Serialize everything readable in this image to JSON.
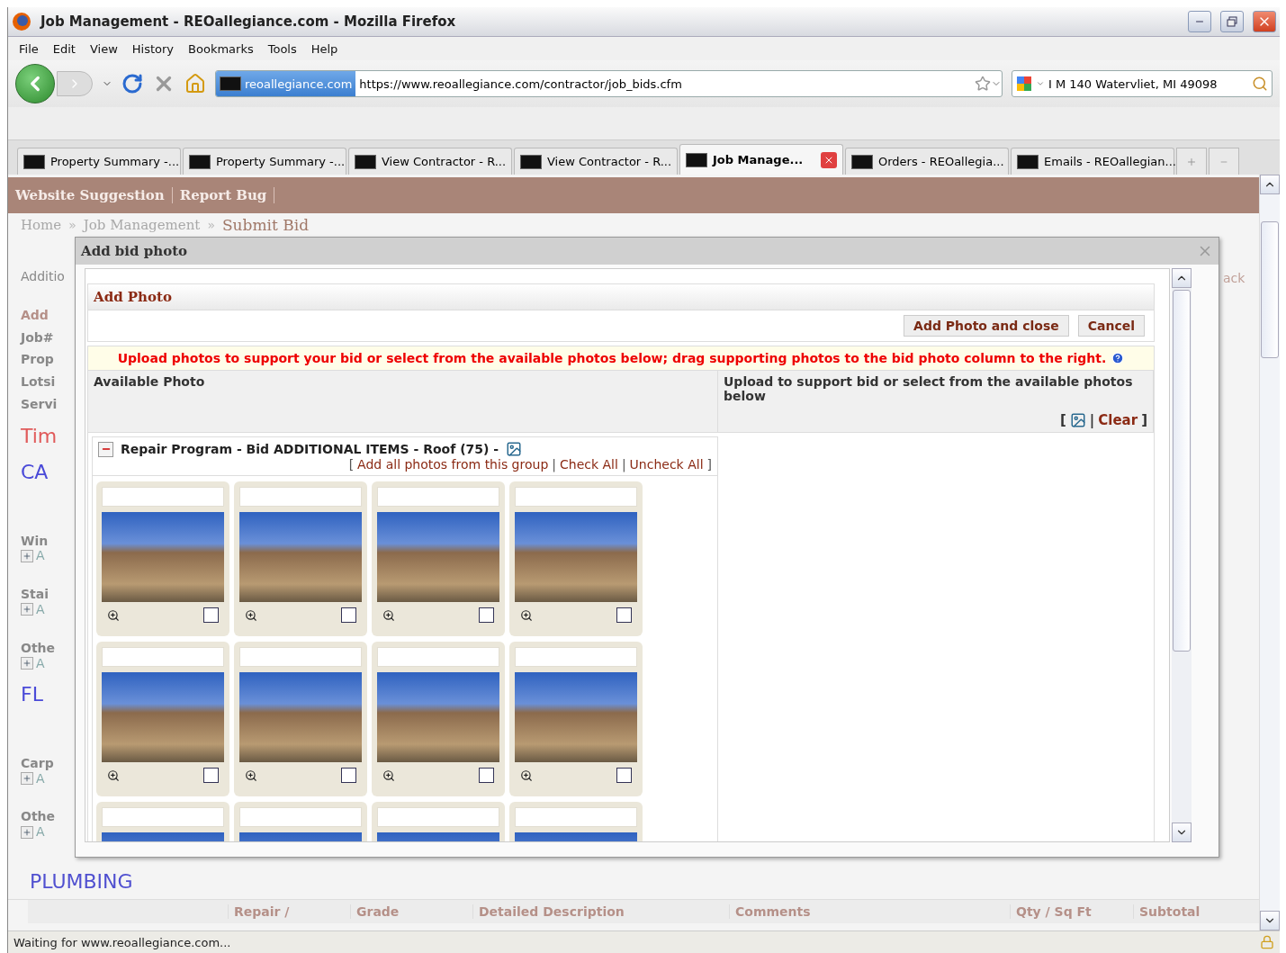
{
  "window": {
    "title": "Job Management - REOallegiance.com - Mozilla Firefox"
  },
  "menu": [
    "File",
    "Edit",
    "View",
    "History",
    "Bookmarks",
    "Tools",
    "Help"
  ],
  "address_bar": {
    "site_badge": "reoallegiance.com",
    "url": "https://www.reoallegiance.com/contractor/job_bids.cfm"
  },
  "search_bar": {
    "value": "I M 140  Watervliet, MI 49098"
  },
  "tabs": [
    {
      "label": "Property Summary -...",
      "selected": false
    },
    {
      "label": "Property Summary -...",
      "selected": false
    },
    {
      "label": "View Contractor - R...",
      "selected": false
    },
    {
      "label": "View Contractor - R...",
      "selected": false
    },
    {
      "label": "Job Manage...",
      "selected": true
    },
    {
      "label": "Orders - REOallegia...",
      "selected": false
    },
    {
      "label": "Emails - REOallegian...",
      "selected": false
    }
  ],
  "page": {
    "nav_links": [
      "Website Suggestion",
      "Report Bug"
    ],
    "breadcrumb_separator": "»",
    "breadcrumb": [
      {
        "label": "Home",
        "current": false
      },
      {
        "label": "Job Management",
        "current": false
      },
      {
        "label": "Submit Bid",
        "current": true
      }
    ],
    "left_fragments": [
      {
        "kind": "plain",
        "text": "Additio"
      },
      {
        "kind": "header",
        "text": "Add"
      },
      {
        "kind": "field",
        "text": "Job#"
      },
      {
        "kind": "field",
        "text": "Prop"
      },
      {
        "kind": "field",
        "text": "Lotsi"
      },
      {
        "kind": "field",
        "text": "Servi"
      },
      {
        "kind": "section",
        "text": "Tim",
        "color": "#e05a5a"
      },
      {
        "kind": "section",
        "text": "CA",
        "color": "#4a4ad8"
      },
      {
        "kind": "item",
        "text": "Win",
        "link": "A"
      },
      {
        "kind": "item",
        "text": "Stai",
        "link": "A"
      },
      {
        "kind": "item",
        "text": "Othe",
        "link": "A"
      },
      {
        "kind": "section",
        "text": "FL",
        "color": "#4a4ad8"
      },
      {
        "kind": "item",
        "text": "Carp",
        "link": "A"
      },
      {
        "kind": "item",
        "text": "Othe",
        "link": "A"
      }
    ],
    "right_fragment": "ack",
    "section_title": "PLUMBING",
    "table_columns": [
      "Repair /",
      "Grade",
      "Detailed Description",
      "Comments",
      "Qty / Sq Ft",
      "Subtotal"
    ]
  },
  "dialog": {
    "title": "Add bid photo",
    "panel_title": "Add Photo",
    "buttons": [
      "Add Photo and close",
      "Cancel"
    ],
    "notice": "Upload photos to support your bid or select from the available photos below; drag supporting photos to the bid photo column to the right.",
    "left_header": "Available Photo",
    "right_header": "Upload to support bid or select from the available photos below",
    "right_links": {
      "open": "[",
      "separator": "|",
      "clear": "Clear",
      "close": "]"
    },
    "group": {
      "expanded": true,
      "title": "Repair Program - Bid ADDITIONAL ITEMS - Roof (75) -",
      "link_open": "[",
      "link_separator": "|",
      "link_close": "]",
      "links": [
        "Add all photos from this group",
        "Check All",
        "Uncheck All"
      ],
      "photos": [
        {
          "checked": false
        },
        {
          "checked": false
        },
        {
          "checked": false
        },
        {
          "checked": false
        },
        {
          "checked": false
        },
        {
          "checked": false
        },
        {
          "checked": false
        },
        {
          "checked": false
        }
      ],
      "more_photos_below": true
    }
  },
  "status_bar": {
    "text": "Waiting for www.reoallegiance.com..."
  }
}
